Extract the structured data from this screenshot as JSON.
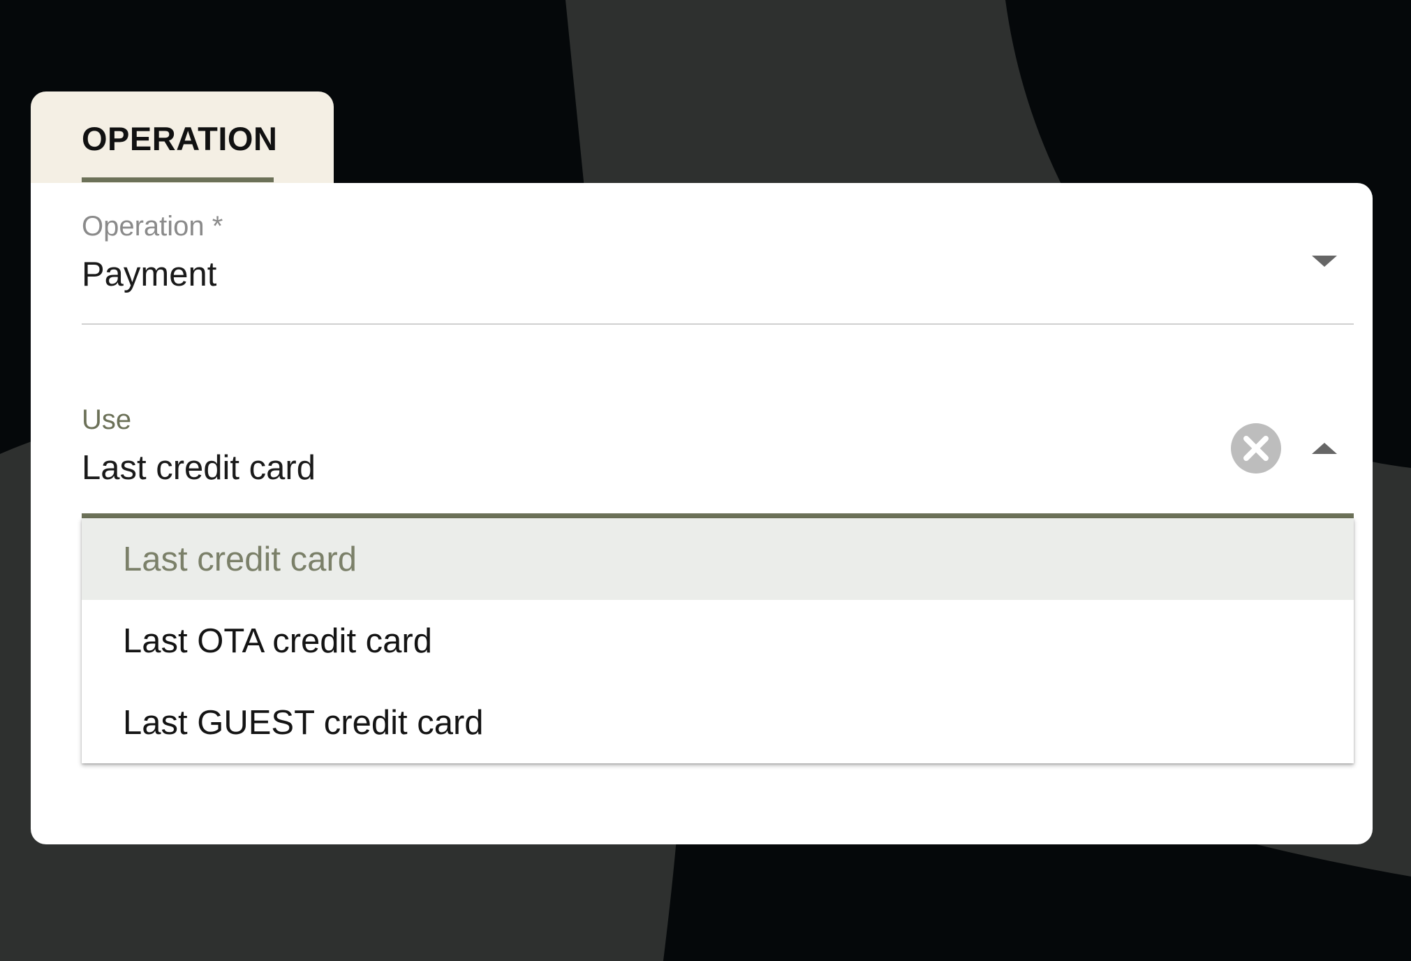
{
  "tab": {
    "label": "OPERATION"
  },
  "operation_field": {
    "label": "Operation *",
    "value": "Payment"
  },
  "use_field": {
    "label": "Use",
    "value": "Last credit card",
    "dropdown_open": true
  },
  "dropdown": {
    "options": [
      {
        "label": "Last credit card",
        "selected": true
      },
      {
        "label": "Last OTA credit card",
        "selected": false
      },
      {
        "label": "Last GUEST credit card",
        "selected": false
      }
    ]
  },
  "colors": {
    "background": "#05080a",
    "background_shape": "#2e302f",
    "tab_background": "#f4efe4",
    "accent": "#6c7158",
    "card": "#ffffff",
    "selected_option_bg": "#ebedea",
    "selected_option_text": "#7b8069",
    "clear_icon": "#bdbdbd"
  },
  "icons": {
    "operation_arrow": "arrow-drop-down-icon",
    "use_clear": "clear-circle-icon",
    "use_arrow": "arrow-drop-up-icon"
  }
}
